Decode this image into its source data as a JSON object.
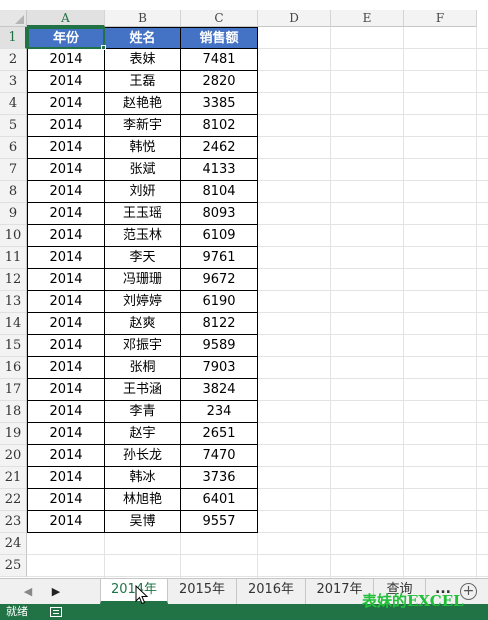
{
  "columns": [
    "A",
    "B",
    "C",
    "D",
    "E",
    "F"
  ],
  "active_column": "A",
  "rows": [
    "1",
    "2",
    "3",
    "4",
    "5",
    "6",
    "7",
    "8",
    "9",
    "10",
    "11",
    "12",
    "13",
    "14",
    "15",
    "16",
    "17",
    "18",
    "19",
    "20",
    "21",
    "22",
    "23",
    "24",
    "25"
  ],
  "active_row": "1",
  "table": {
    "headers": [
      "年份",
      "姓名",
      "销售额"
    ],
    "records": [
      [
        "2014",
        "表妹",
        "7481"
      ],
      [
        "2014",
        "王磊",
        "2820"
      ],
      [
        "2014",
        "赵艳艳",
        "3385"
      ],
      [
        "2014",
        "李新宇",
        "8102"
      ],
      [
        "2014",
        "韩悦",
        "2462"
      ],
      [
        "2014",
        "张斌",
        "4133"
      ],
      [
        "2014",
        "刘妍",
        "8104"
      ],
      [
        "2014",
        "王玉瑶",
        "8093"
      ],
      [
        "2014",
        "范玉林",
        "6109"
      ],
      [
        "2014",
        "李天",
        "9761"
      ],
      [
        "2014",
        "冯珊珊",
        "9672"
      ],
      [
        "2014",
        "刘婷婷",
        "6190"
      ],
      [
        "2014",
        "赵爽",
        "8122"
      ],
      [
        "2014",
        "邓振宇",
        "9589"
      ],
      [
        "2014",
        "张桐",
        "7903"
      ],
      [
        "2014",
        "王书涵",
        "3824"
      ],
      [
        "2014",
        "李青",
        "234"
      ],
      [
        "2014",
        "赵宇",
        "2651"
      ],
      [
        "2014",
        "孙长龙",
        "7470"
      ],
      [
        "2014",
        "韩冰",
        "3736"
      ],
      [
        "2014",
        "林旭艳",
        "6401"
      ],
      [
        "2014",
        "吴博",
        "9557"
      ]
    ]
  },
  "sheet_tabs": [
    {
      "label": "2014年",
      "active": true
    },
    {
      "label": "2015年",
      "active": false
    },
    {
      "label": "2016年",
      "active": false
    },
    {
      "label": "2017年",
      "active": false
    },
    {
      "label": "查询",
      "active": false
    }
  ],
  "tab_nav": {
    "prev": "◀",
    "next": "▶",
    "more": "...",
    "add": "+"
  },
  "status": {
    "text": "就绪"
  },
  "watermark": "表妹的EXCEL",
  "colors": {
    "header_fill": "#4472c4",
    "accent": "#217346",
    "watermark": "#22c03a"
  }
}
